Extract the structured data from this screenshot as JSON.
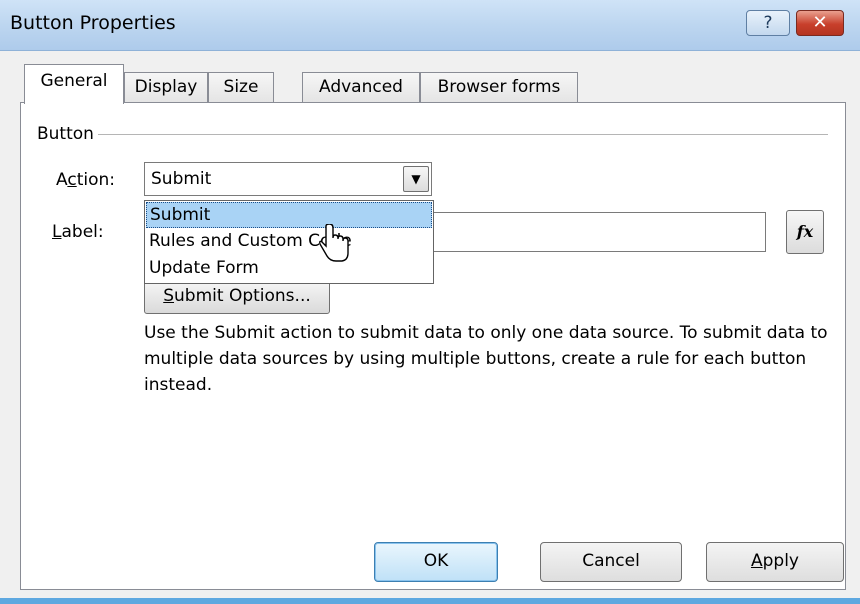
{
  "window": {
    "title": "Button Properties",
    "help_label": "?",
    "close_label": "✕"
  },
  "tabs": [
    {
      "label": "General",
      "active": true
    },
    {
      "label": "Display",
      "active": false
    },
    {
      "label": "Size",
      "active": false
    },
    {
      "label": "Advanced",
      "active": false
    },
    {
      "label": "Browser forms",
      "active": false
    }
  ],
  "general": {
    "group_label": "Button",
    "action_label_pre": "A",
    "action_label_mnemonic": "c",
    "action_label_post": "tion:",
    "action_value": "Submit",
    "label_label_mnemonic": "L",
    "label_label_post": "abel:",
    "label_value": "",
    "fx_label": "fx",
    "submit_options_mnemonic": "S",
    "submit_options_post": "ubmit Options...",
    "dropdown_options": [
      "Submit",
      "Rules and Custom Code",
      "Update Form"
    ],
    "dropdown_selected": "Submit",
    "description": "Use the Submit action to submit data to only one data source. To submit data to multiple data sources by using multiple buttons, create a rule for each button instead."
  },
  "footer": {
    "ok_label": "OK",
    "cancel_label": "Cancel",
    "apply_mnemonic": "A",
    "apply_post": "pply"
  }
}
